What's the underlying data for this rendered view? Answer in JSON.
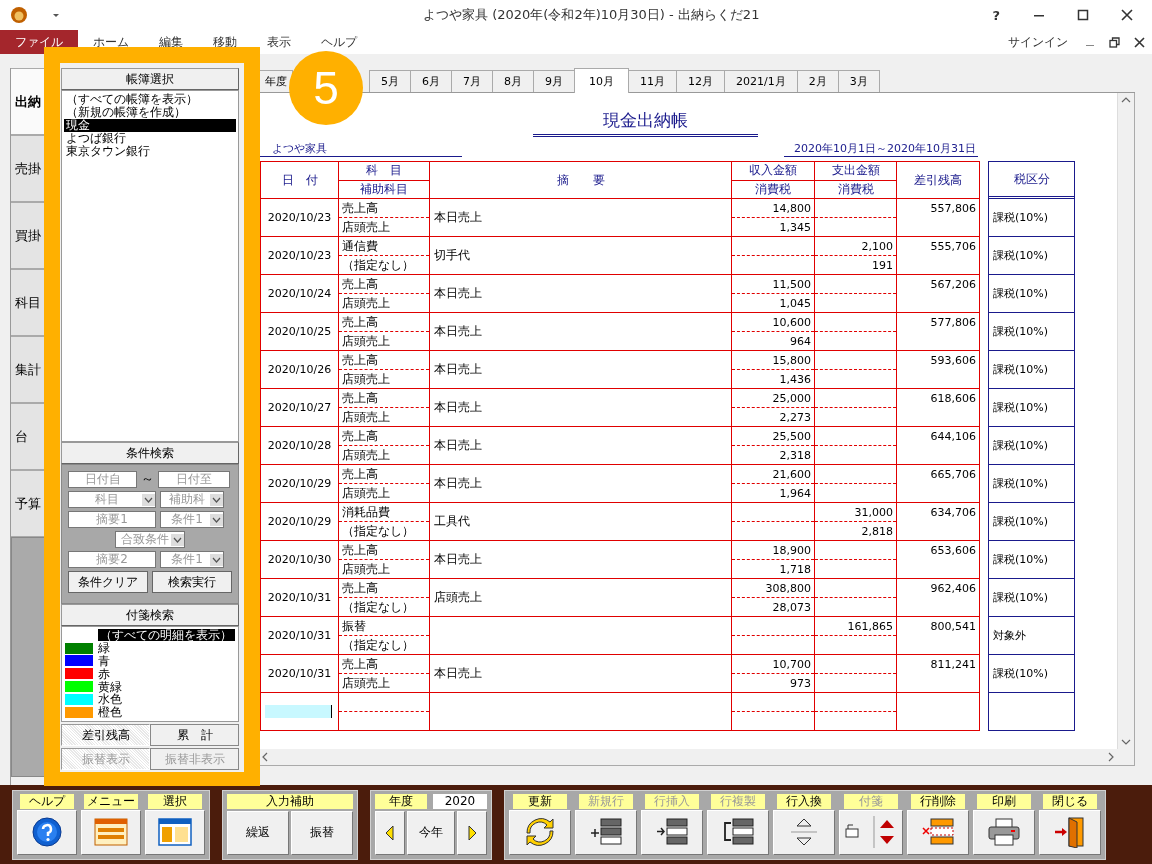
{
  "window": {
    "title": "よつや家具 (2020年(令和2年)10月30日) - 出納らくだ21",
    "help": "?"
  },
  "menu": [
    {
      "label": "ファイル",
      "selected": true
    },
    {
      "label": "ホーム",
      "selected": false
    },
    {
      "label": "編集",
      "selected": false
    },
    {
      "label": "移動",
      "selected": false
    },
    {
      "label": "表示",
      "selected": false
    },
    {
      "label": "ヘルプ",
      "selected": false
    }
  ],
  "signin": "サインイン",
  "side_tabs": [
    {
      "label": "出納",
      "selected": true
    },
    {
      "label": "売掛",
      "selected": false
    },
    {
      "label": "買掛",
      "selected": false
    },
    {
      "label": "科目",
      "selected": false
    },
    {
      "label": "集計",
      "selected": false
    },
    {
      "label": "台",
      "selected": false
    },
    {
      "label": "予算",
      "selected": false
    }
  ],
  "book_panel": {
    "header": "帳簿選択",
    "items": [
      {
        "label": "（すべての帳簿を表示）",
        "selected": false
      },
      {
        "label": "（新規の帳簿を作成）",
        "selected": false
      },
      {
        "label": "現金",
        "selected": true
      },
      {
        "label": "よつば銀行",
        "selected": false
      },
      {
        "label": "東京タウン銀行",
        "selected": false
      }
    ]
  },
  "search_panel": {
    "header": "条件検索",
    "date_from": "日付自",
    "tilde": "～",
    "date_to": "日付至",
    "account": "科目",
    "sub_account": "補助科",
    "memo1": "摘要1",
    "cond1": "条件1",
    "match": "合致条件",
    "memo2": "摘要2",
    "cond2": "条件1",
    "buttons": [
      "条件クリア",
      "検索実行"
    ]
  },
  "tag_panel": {
    "header": "付箋検索",
    "items": [
      {
        "label": "（すべての明細を表示）",
        "selected": true
      },
      {
        "label": "緑",
        "color": "#008000",
        "selected": false
      },
      {
        "label": "青",
        "color": "#0000ff",
        "selected": false
      },
      {
        "label": "赤",
        "color": "#ff0000",
        "selected": false
      },
      {
        "label": "黄緑",
        "color": "#00ff00",
        "selected": false
      },
      {
        "label": "水色",
        "color": "#00ffff",
        "selected": false
      },
      {
        "label": "橙色",
        "color": "#ff9900",
        "selected": false
      }
    ]
  },
  "mode_buttons": [
    {
      "label": "差引残高",
      "selected": true
    },
    {
      "label": "累　計",
      "selected": false
    }
  ],
  "transfer_buttons": [
    {
      "label": "振替表示",
      "selected": true,
      "disabled": true
    },
    {
      "label": "振替非表示",
      "selected": false,
      "disabled": true
    }
  ],
  "month_tabs": [
    {
      "label": "年度",
      "selected": false
    },
    {
      "label": "5月",
      "selected": false
    },
    {
      "label": "6月",
      "selected": false
    },
    {
      "label": "7月",
      "selected": false
    },
    {
      "label": "8月",
      "selected": false
    },
    {
      "label": "9月",
      "selected": false
    },
    {
      "label": "10月",
      "selected": true
    },
    {
      "label": "11月",
      "selected": false
    },
    {
      "label": "12月",
      "selected": false
    },
    {
      "label": "2021/1月",
      "selected": false
    },
    {
      "label": "2月",
      "selected": false
    },
    {
      "label": "3月",
      "selected": false
    }
  ],
  "callout": {
    "number": "5"
  },
  "ledger": {
    "title": "現金出納帳",
    "company": "よつや家具",
    "period": "2020年10月1日～2020年10月31日",
    "columns": {
      "date": "日　付",
      "account": "科　目",
      "sub_account": "補助科目",
      "memo": "摘　　要",
      "income": "収入金額",
      "income_tax": "消費税",
      "expense": "支出金額",
      "expense_tax": "消費税",
      "balance": "差引残高",
      "tax_class": "税区分"
    },
    "rows": [
      {
        "date": "2020/10/23",
        "account": "売上高",
        "sub": "店頭売上",
        "memo": "本日売上",
        "income": "14,800",
        "income_tax": "1,345",
        "balance": "557,806",
        "tax_class": "課税(10%)"
      },
      {
        "date": "2020/10/23",
        "account": "通信費",
        "sub": "（指定なし）",
        "memo": "切手代",
        "expense": "2,100",
        "expense_tax": "191",
        "balance": "555,706",
        "tax_class": "課税(10%)"
      },
      {
        "date": "2020/10/24",
        "account": "売上高",
        "sub": "店頭売上",
        "memo": "本日売上",
        "income": "11,500",
        "income_tax": "1,045",
        "balance": "567,206",
        "tax_class": "課税(10%)"
      },
      {
        "date": "2020/10/25",
        "account": "売上高",
        "sub": "店頭売上",
        "memo": "本日売上",
        "income": "10,600",
        "income_tax": "964",
        "balance": "577,806",
        "tax_class": "課税(10%)"
      },
      {
        "date": "2020/10/26",
        "account": "売上高",
        "sub": "店頭売上",
        "memo": "本日売上",
        "income": "15,800",
        "income_tax": "1,436",
        "balance": "593,606",
        "tax_class": "課税(10%)"
      },
      {
        "date": "2020/10/27",
        "account": "売上高",
        "sub": "店頭売上",
        "memo": "本日売上",
        "income": "25,000",
        "income_tax": "2,273",
        "balance": "618,606",
        "tax_class": "課税(10%)"
      },
      {
        "date": "2020/10/28",
        "account": "売上高",
        "sub": "店頭売上",
        "memo": "本日売上",
        "income": "25,500",
        "income_tax": "2,318",
        "balance": "644,106",
        "tax_class": "課税(10%)"
      },
      {
        "date": "2020/10/29",
        "account": "売上高",
        "sub": "店頭売上",
        "memo": "本日売上",
        "income": "21,600",
        "income_tax": "1,964",
        "balance": "665,706",
        "tax_class": "課税(10%)"
      },
      {
        "date": "2020/10/29",
        "account": "消耗品費",
        "sub": "（指定なし）",
        "memo": "工具代",
        "expense": "31,000",
        "expense_tax": "2,818",
        "balance": "634,706",
        "tax_class": "課税(10%)"
      },
      {
        "date": "2020/10/30",
        "account": "売上高",
        "sub": "店頭売上",
        "memo": "本日売上",
        "income": "18,900",
        "income_tax": "1,718",
        "balance": "653,606",
        "tax_class": "課税(10%)"
      },
      {
        "date": "2020/10/31",
        "account": "売上高",
        "sub": "（指定なし）",
        "memo": "店頭売上",
        "income": "308,800",
        "income_tax": "28,073",
        "balance": "962,406",
        "tax_class": "課税(10%)"
      },
      {
        "date": "2020/10/31",
        "account": "振替",
        "sub": "（指定なし）",
        "expense": "161,865",
        "balance": "800,541",
        "tax_class": "対象外"
      },
      {
        "date": "2020/10/31",
        "account": "売上高",
        "sub": "店頭売上",
        "memo": "本日売上",
        "income": "10,700",
        "income_tax": "973",
        "balance": "811,241",
        "tax_class": "課税(10%)"
      }
    ]
  },
  "toolbar": {
    "nav_group": [
      {
        "label": "ヘルプ",
        "kind": "help"
      },
      {
        "label": "メニュー",
        "kind": "menu"
      },
      {
        "label": "選択",
        "kind": "select"
      }
    ],
    "input_group": {
      "header": "入力補助",
      "buttons": [
        "繰返",
        "振替"
      ]
    },
    "year_group": {
      "label": "年度",
      "value": "2020",
      "today": "今年"
    },
    "tools": [
      {
        "label": "更新",
        "kind": "refresh",
        "disabled": false
      },
      {
        "label": "新規行",
        "kind": "new_row",
        "disabled": true
      },
      {
        "label": "行挿入",
        "kind": "insert",
        "disabled": true
      },
      {
        "label": "行複製",
        "kind": "copy",
        "disabled": true
      },
      {
        "label": "行入換",
        "kind": "swap",
        "disabled": false
      },
      {
        "label": "付箋",
        "kind": "tag",
        "disabled": true
      },
      {
        "label": "行削除",
        "kind": "delete",
        "disabled": false
      },
      {
        "label": "印刷",
        "kind": "print",
        "disabled": false
      },
      {
        "label": "閉じる",
        "kind": "close",
        "disabled": false
      }
    ]
  }
}
